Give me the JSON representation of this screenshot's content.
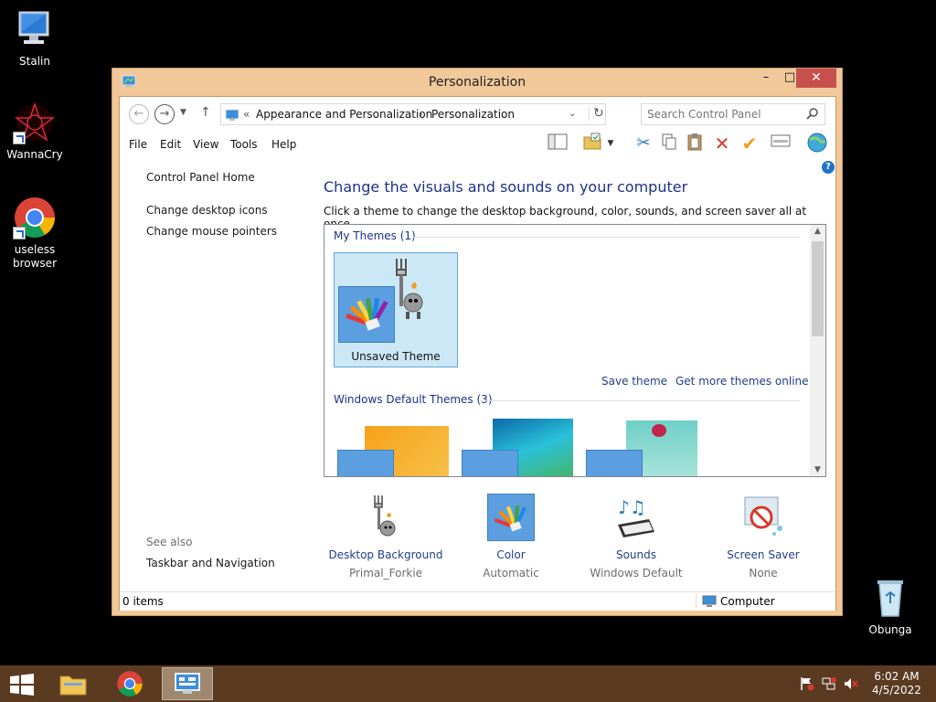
{
  "desktop": {
    "icons": [
      {
        "label": "Stalin"
      },
      {
        "label": "WannaCry"
      },
      {
        "label": "useless browser"
      },
      {
        "label": "Obunga"
      }
    ]
  },
  "window": {
    "title": "Personalization",
    "controls": {
      "minimize": "–",
      "maximize": "□",
      "close": "✕"
    }
  },
  "nav": {
    "crumb_sep": "«",
    "breadcrumb": [
      "Appearance and Personalization",
      "Personalization"
    ],
    "crumb_arrow": "›",
    "search_placeholder": "Search Control Panel"
  },
  "menu": [
    "File",
    "Edit",
    "View",
    "Tools",
    "Help"
  ],
  "left_pane": {
    "home": "Control Panel Home",
    "links": [
      "Change desktop icons",
      "Change mouse pointers"
    ],
    "see_also_label": "See also",
    "see_also_links": [
      "Taskbar and Navigation"
    ]
  },
  "main": {
    "heading": "Change the visuals and sounds on your computer",
    "description": "Click a theme to change the desktop background, color, sounds, and screen saver all at once.",
    "my_themes_title": "My Themes (1)",
    "unsaved_theme": "Unsaved Theme",
    "save_theme": "Save theme",
    "get_more": "Get more themes online",
    "default_themes_title": "Windows Default Themes (3)"
  },
  "options": [
    {
      "label": "Desktop Background",
      "value": "Primal_Forkie"
    },
    {
      "label": "Color",
      "value": "Automatic"
    },
    {
      "label": "Sounds",
      "value": "Windows Default"
    },
    {
      "label": "Screen Saver",
      "value": "None"
    }
  ],
  "status": {
    "items": "0 items",
    "location": "Computer"
  },
  "taskbar": {
    "time": "6:02 AM",
    "date": "4/5/2022"
  },
  "colors": {
    "accent_blue": "#1e3287",
    "link_blue": "#1f3f8a",
    "taskbar": "#5a3b22",
    "window_frame": "#f0c89a",
    "close_red": "#c7504c"
  }
}
